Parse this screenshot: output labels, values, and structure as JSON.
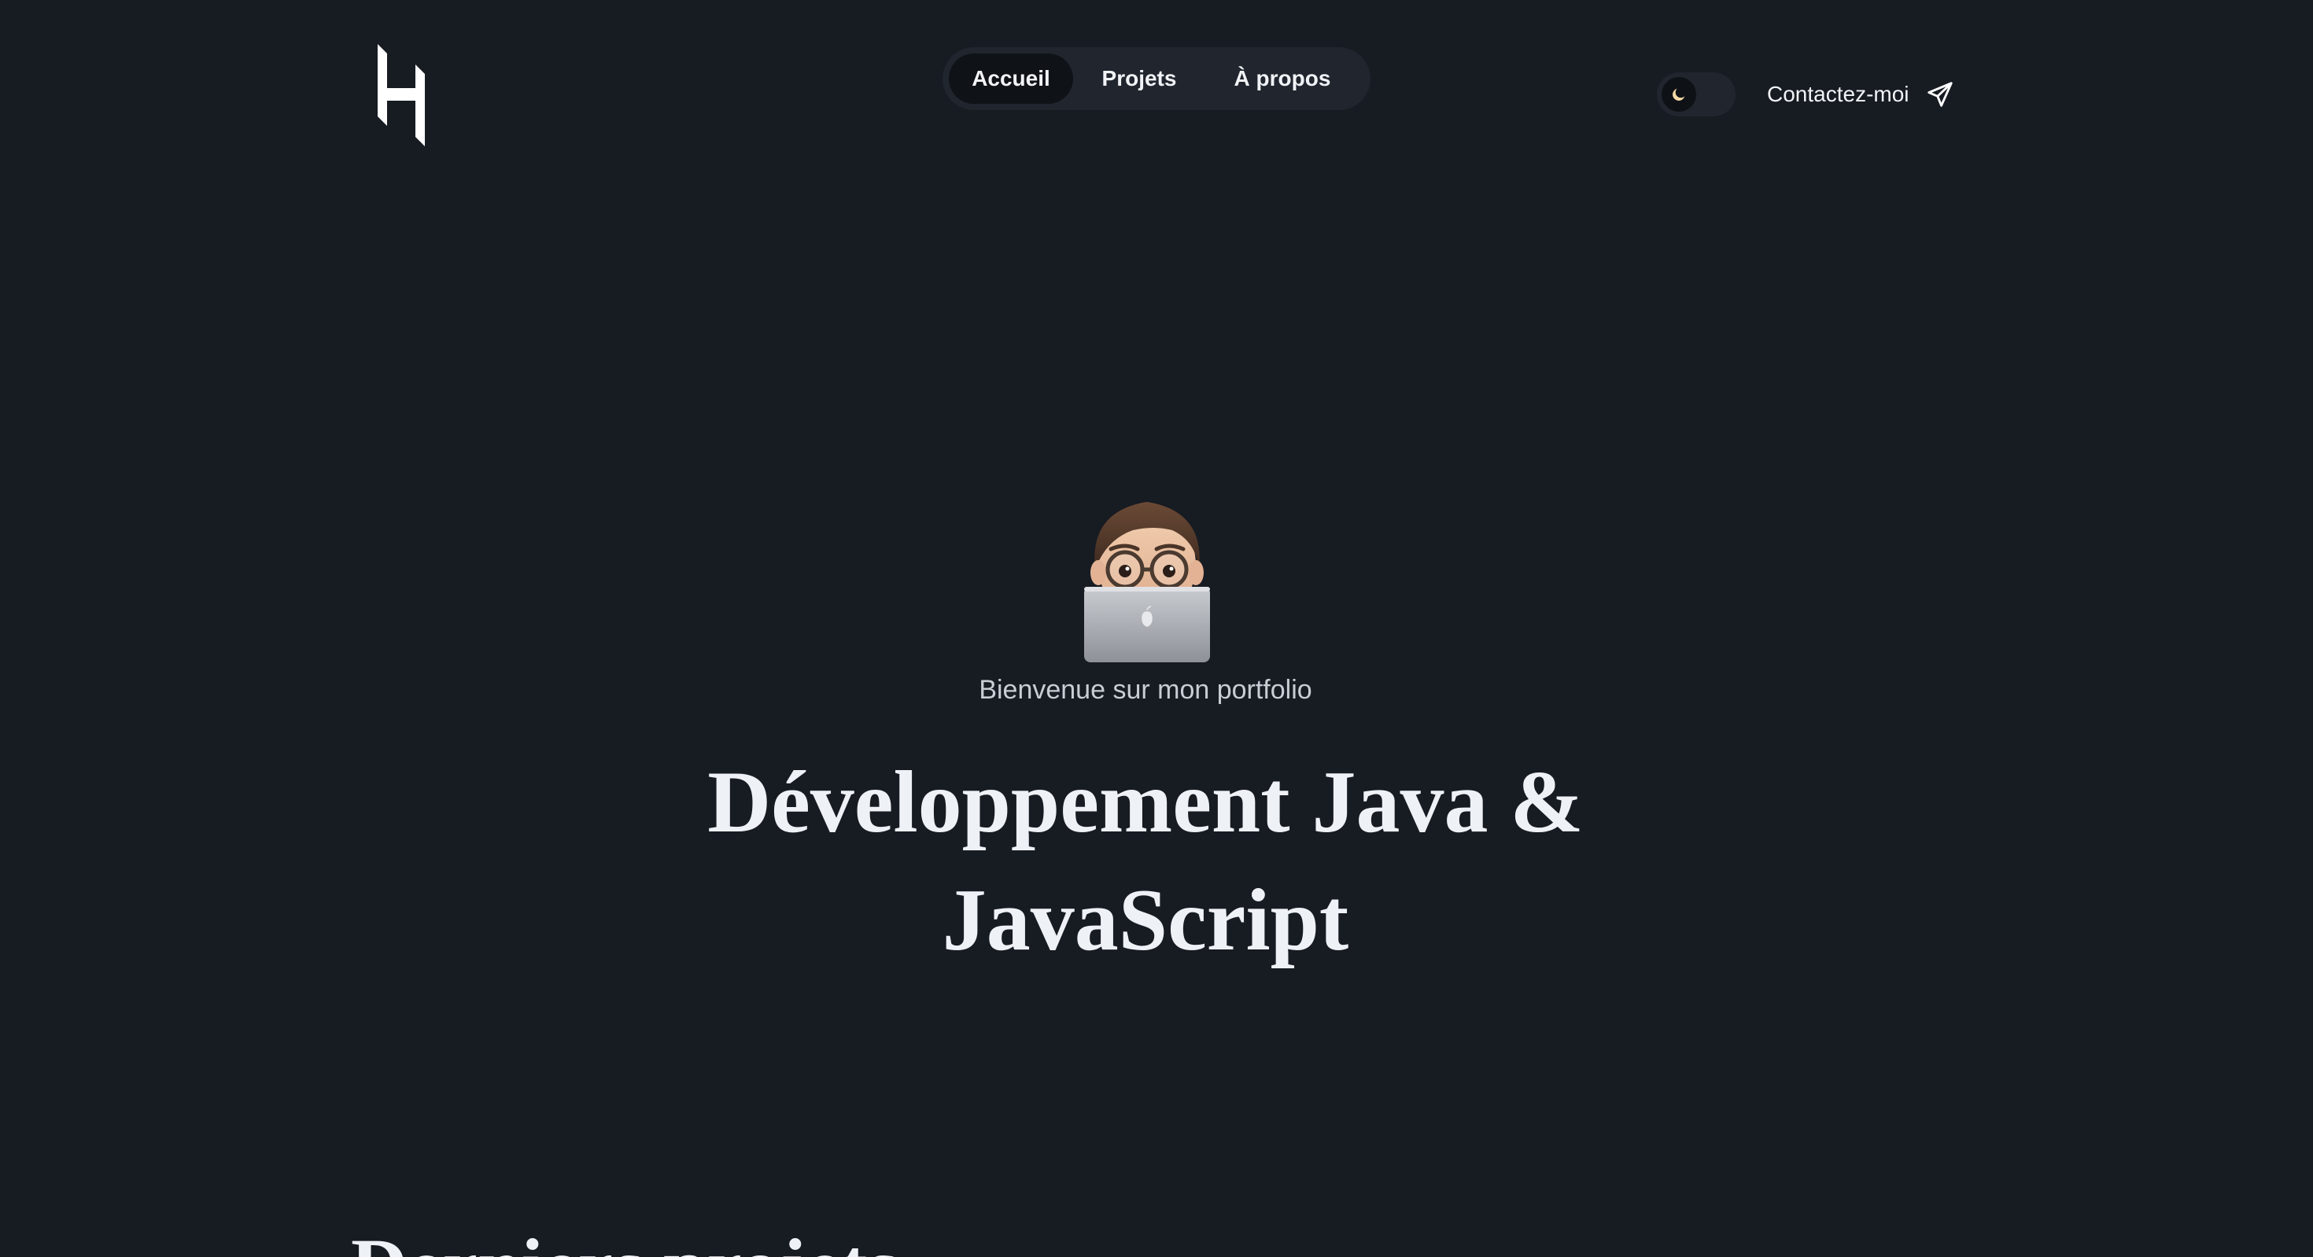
{
  "header": {
    "logo_icon": "h-monogram-logo",
    "nav": [
      {
        "label": "Accueil",
        "active": true
      },
      {
        "label": "Projets",
        "active": false
      },
      {
        "label": "À propos",
        "active": false
      }
    ],
    "theme_toggle": {
      "mode": "dark",
      "icon": "moon-icon"
    },
    "contact": {
      "label": "Contactez-moi",
      "icon": "paper-plane-icon"
    }
  },
  "hero": {
    "avatar_icon": "memoji-laptop-avatar",
    "welcome": "Bienvenue sur mon portfolio",
    "title_line1": "Développement Java &",
    "title_line2": "JavaScript"
  },
  "next_section": {
    "title_visible": "Derniers projets"
  },
  "colors": {
    "background": "#171b22",
    "nav_background": "#20252e",
    "nav_active": "#0f1217",
    "text": "#eef1f5",
    "moon": "#f3d9a4"
  }
}
